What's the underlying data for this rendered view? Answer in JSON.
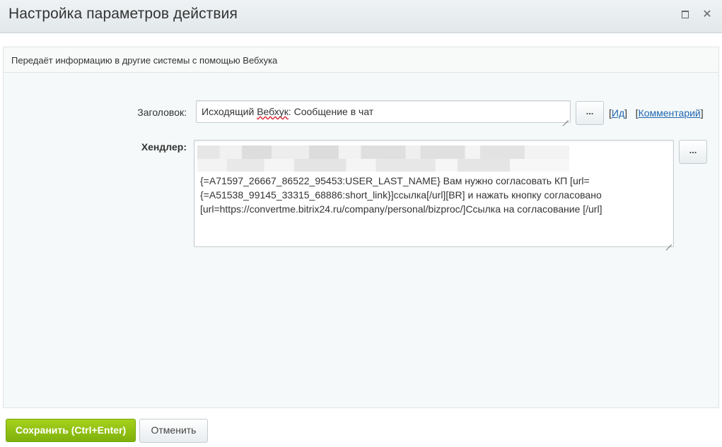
{
  "dialog": {
    "title": "Настройка параметров действия"
  },
  "description": "Передаёт информацию в другие системы с помощью Вебхука",
  "fields": {
    "title": {
      "label": "Заголовок:",
      "value_prefix": "Исходящий ",
      "value_spell": "Вебхук",
      "value_suffix": ": Сообщение в чат",
      "dots_label": "...",
      "link_id": "Ид",
      "link_comment": "Комментарий"
    },
    "handler": {
      "label": "Хендлер:",
      "dots_label": "...",
      "lines": [
        "{=A71597_26667_86522_95453:USER_LAST_NAME} Вам нужно согласовать КП [url=",
        "{=A51538_99145_33315_68886:short_link}]ссылка[/url][BR] и нажать кнопку согласовано",
        "[url=https://convertme.bitrix24.ru/company/personal/bizproc/]Ссылка на согласование [/url]"
      ]
    }
  },
  "buttons": {
    "save": "Сохранить (Ctrl+Enter)",
    "cancel": "Отменить"
  }
}
